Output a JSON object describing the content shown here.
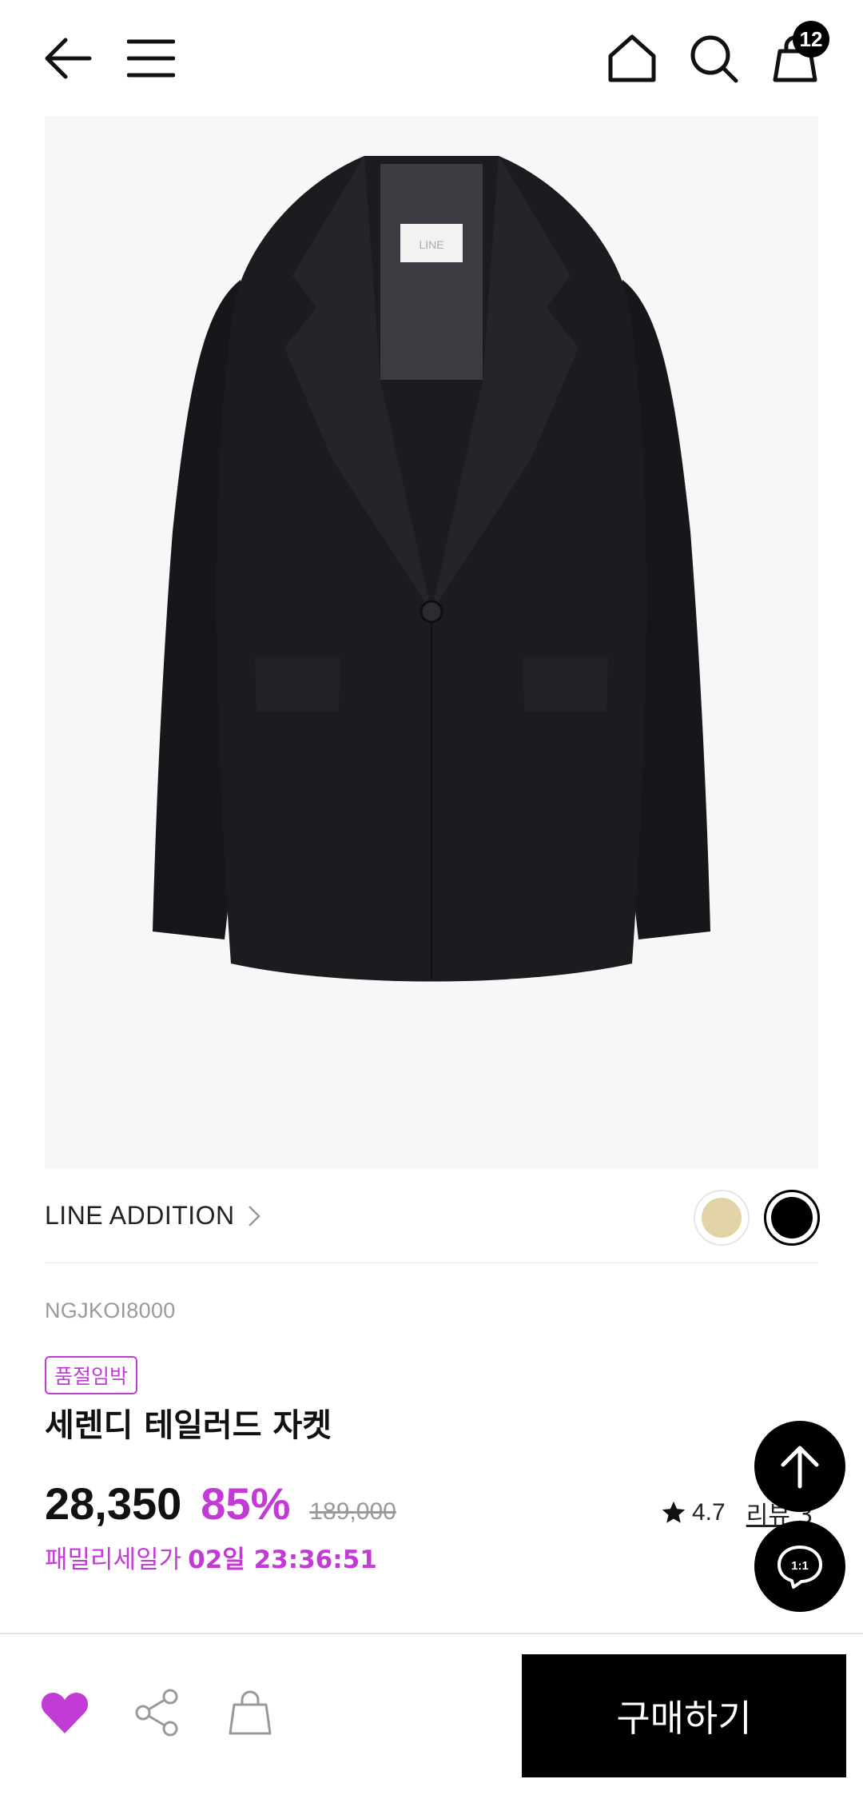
{
  "header": {
    "cart_count": "12",
    "icons": [
      "back-arrow-icon",
      "menu-icon",
      "home-icon",
      "search-icon",
      "shopping-bag-icon"
    ]
  },
  "product": {
    "image_label": "LINE",
    "brand": "LINE ADDITION",
    "sku": "NGJKOI8000",
    "badge": "품절임박",
    "name": "세렌디 테일러드 자켓",
    "colors": [
      {
        "name": "beige",
        "hex": "#e2d3a8",
        "selected": false
      },
      {
        "name": "black",
        "hex": "#000000",
        "selected": true
      }
    ]
  },
  "pricing": {
    "price": "28,350",
    "discount": "85%",
    "original_price": "189,000",
    "sale_label": "패밀리세일가",
    "sale_timer": "02일 23:36:51"
  },
  "rating": {
    "score": "4.7",
    "reviews": "리뷰 3"
  },
  "fabs": {
    "chat_label": "1:1"
  },
  "bottom_bar": {
    "buy_label": "구매하기",
    "accent": "#c23bd4"
  }
}
